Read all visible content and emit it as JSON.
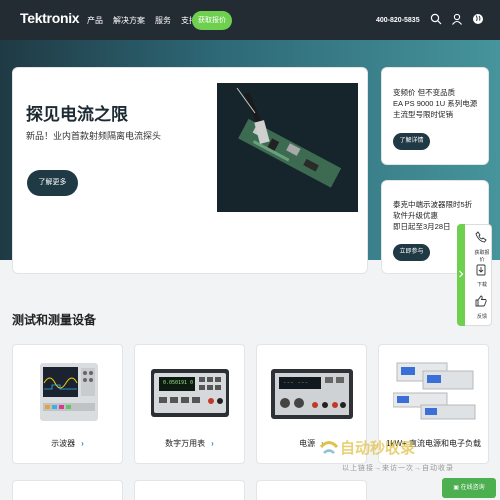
{
  "header": {
    "logo": "Tektronix",
    "nav": [
      "产品",
      "解决方案",
      "服务",
      "支持"
    ],
    "quote_button": "获取报价",
    "phone": "400-820-5835",
    "icons": [
      "search-icon",
      "user-icon",
      "globe-icon"
    ]
  },
  "hero": {
    "title": "探见电流之限",
    "subtitle": "新品！业内首款射频隔离电流探头",
    "button": "了解更多"
  },
  "side_cards": [
    {
      "lines": [
        "变频价 但不变品质",
        "EA PS 9000 1U 系列电源",
        "主流型号限时促销"
      ],
      "button": "了解详情"
    },
    {
      "lines": [
        "泰克中端示波器限时5折",
        "软件升级优惠",
        "即日起至3月28日"
      ],
      "button": "立即参与"
    }
  ],
  "floating": {
    "items": [
      "获取报价",
      "下载",
      "反馈"
    ],
    "icons": [
      "phone-icon",
      "download-icon",
      "thumbs-up-icon"
    ]
  },
  "section": {
    "title": "测试和测量设备",
    "products": [
      {
        "label": "示波器",
        "icon": "oscilloscope-image"
      },
      {
        "label": "数字万用表",
        "icon": "multimeter-image",
        "display": "0.050191 0"
      },
      {
        "label": "电源",
        "icon": "power-supply-image"
      },
      {
        "label": "1kW+ 直流电源和电子负载",
        "icon": "dc-power-image"
      }
    ]
  },
  "watermark": {
    "brand": "自动秒收录",
    "sub": "以上链接→来访一次→自动收录"
  },
  "online_service": "在线咨询",
  "colors": {
    "header_bg": "#232b33",
    "accent_green": "#6fcf4f",
    "button_dark": "#1f3a44",
    "link_blue": "#2d7fd1"
  }
}
